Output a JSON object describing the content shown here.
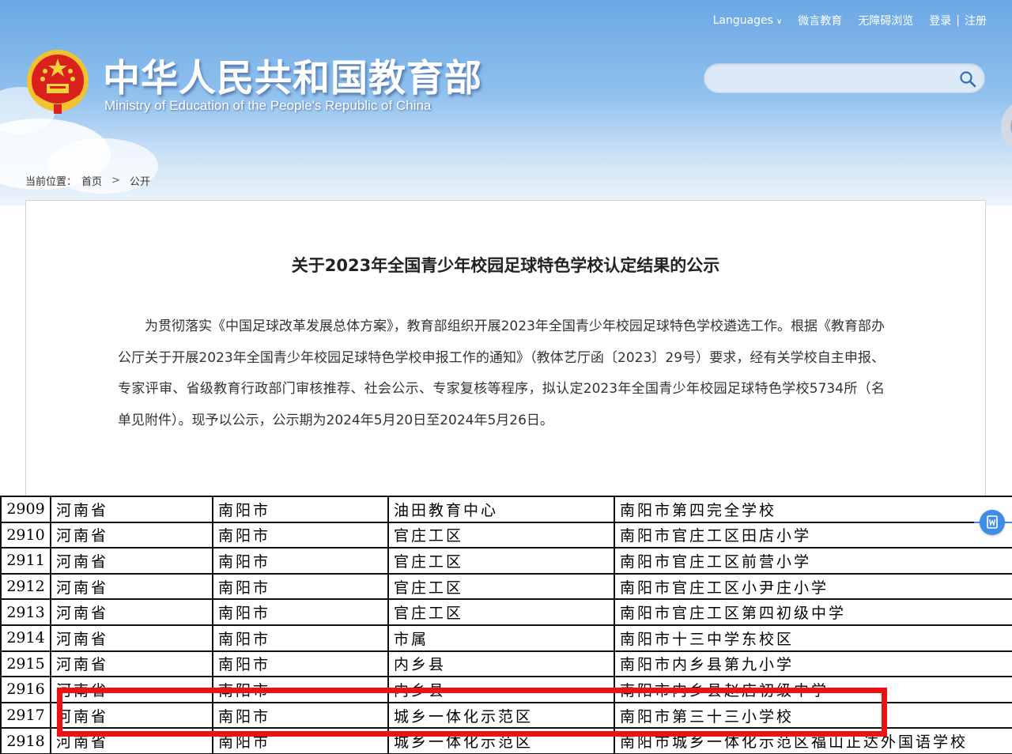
{
  "topnav": {
    "languages": "Languages",
    "weiyan": "微言教育",
    "accessibility": "无障碍浏览",
    "login": "登录",
    "separator": "|",
    "register": "注册"
  },
  "site": {
    "title": "中华人民共和国教育部",
    "subtitle": "Ministry of Education of the People's Republic of China"
  },
  "search": {
    "placeholder": ""
  },
  "breadcrumb": {
    "label": "当前位置：",
    "home": "首页",
    "separator": ">",
    "current": "公开"
  },
  "article": {
    "title": "关于2023年全国青少年校园足球特色学校认定结果的公示",
    "body": "为贯彻落实《中国足球改革发展总体方案》，教育部组织开展2023年全国青少年校园足球特色学校遴选工作。根据《教育部办公厅关于开展2023年全国青少年校园足球特色学校申报工作的通知》（教体艺厅函〔2023〕29号）要求，经有关学校自主申报、专家评审、省级教育行政部门审核推荐、社会公示、专家复核等程序，拟认定2023年全国青少年校园足球特色学校5734所（名单见附件）。现予以公示，公示期为2024年5月20日至2024年5月26日。"
  },
  "table": {
    "rows": [
      {
        "no": "2909",
        "province": "河南省",
        "city": "南阳市",
        "district": "油田教育中心",
        "school": "南阳市第四完全学校"
      },
      {
        "no": "2910",
        "province": "河南省",
        "city": "南阳市",
        "district": "官庄工区",
        "school": "南阳市官庄工区田店小学"
      },
      {
        "no": "2911",
        "province": "河南省",
        "city": "南阳市",
        "district": "官庄工区",
        "school": "南阳市官庄工区前营小学"
      },
      {
        "no": "2912",
        "province": "河南省",
        "city": "南阳市",
        "district": "官庄工区",
        "school": "南阳市官庄工区小尹庄小学"
      },
      {
        "no": "2913",
        "province": "河南省",
        "city": "南阳市",
        "district": "官庄工区",
        "school": "南阳市官庄工区第四初级中学"
      },
      {
        "no": "2914",
        "province": "河南省",
        "city": "南阳市",
        "district": "市属",
        "school": "南阳市十三中学东校区"
      },
      {
        "no": "2915",
        "province": "河南省",
        "city": "南阳市",
        "district": "内乡县",
        "school": "南阳市内乡县第九小学"
      },
      {
        "no": "2916",
        "province": "河南省",
        "city": "南阳市",
        "district": "内乡县",
        "school": "南阳市内乡县赵店初级中学"
      },
      {
        "no": "2917",
        "province": "河南省",
        "city": "南阳市",
        "district": "城乡一体化示范区",
        "school": "南阳市第三十三小学校"
      },
      {
        "no": "2918",
        "province": "河南省",
        "city": "南阳市",
        "district": "城乡一体化示范区",
        "school": "南阳市城乡一体化示范区福山正达外国语学校"
      }
    ]
  },
  "colors": {
    "header_top": "#6aa8e4",
    "highlight": "#ee1111",
    "badge": "#3f8de6"
  },
  "icons": {
    "emblem": "national-emblem",
    "search": "search-icon",
    "chevron": "chevron-down-icon",
    "word": "word-document-icon"
  }
}
